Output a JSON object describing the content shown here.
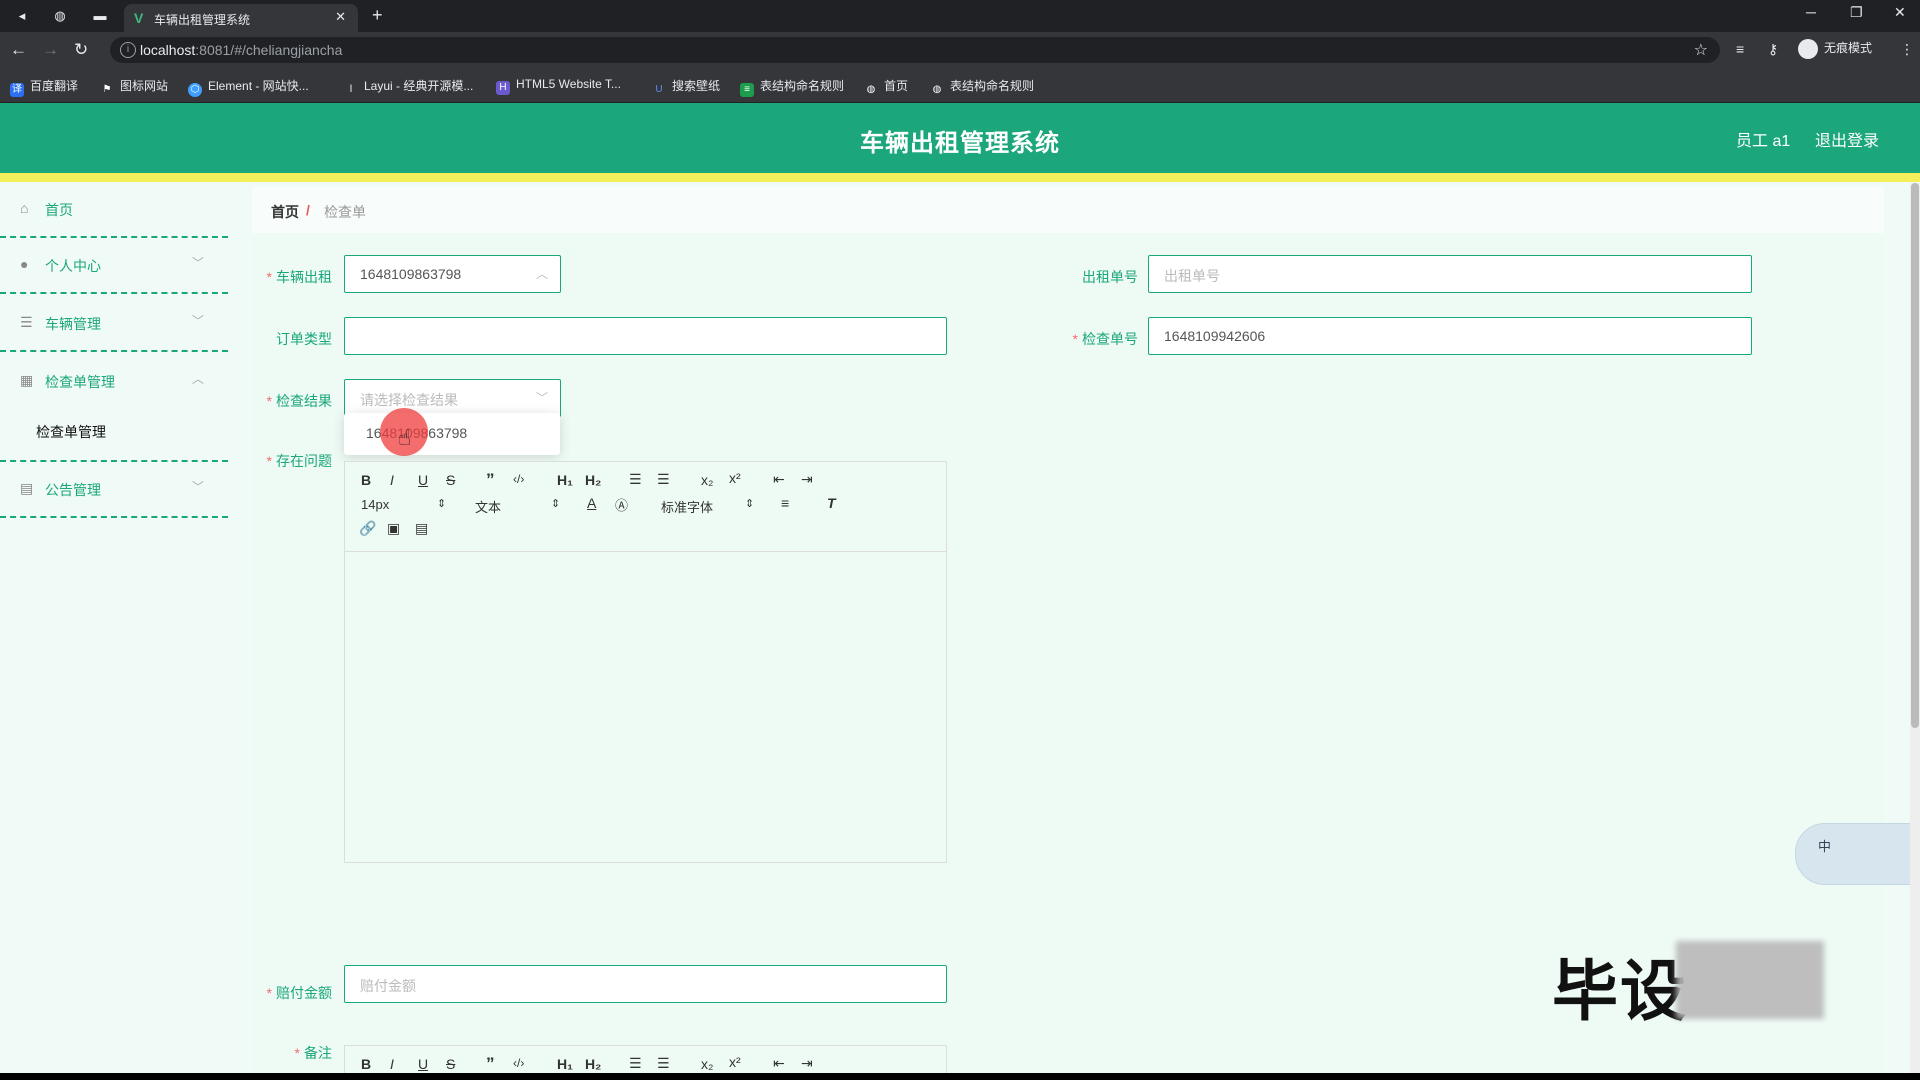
{
  "browser": {
    "tab_title": "车辆出租管理系统",
    "url_host": "localhost",
    "url_rest": ":8081/#/cheliangjiancha",
    "profile_label": "无痕模式",
    "bookmarks": [
      "百度翻译",
      "图标网站",
      "Element - 网站快...",
      "Layui - 经典开源模...",
      "HTML5 Website T...",
      "搜索壁纸",
      "表结构命名规则",
      "首页",
      "表结构命名规则"
    ]
  },
  "header": {
    "title": "车辆出租管理系统",
    "user": "员工 a1",
    "logout": "退出登录"
  },
  "sidebar": {
    "items": [
      {
        "label": "首页",
        "icon": "home-icon"
      },
      {
        "label": "个人中心",
        "icon": "user-icon"
      },
      {
        "label": "车辆管理",
        "icon": "list-icon"
      },
      {
        "label": "检查单管理",
        "icon": "grid-icon"
      },
      {
        "label": "公告管理",
        "icon": "notice-icon"
      }
    ],
    "submenu": "检查单管理"
  },
  "breadcrumb": {
    "home": "首页",
    "separator": "/",
    "current": "检查单"
  },
  "form": {
    "car_rent": {
      "label": "车辆出租",
      "value": "1648109863798"
    },
    "rent_no": {
      "label": "出租单号",
      "placeholder": "出租单号"
    },
    "order_type": {
      "label": "订单类型"
    },
    "check_no": {
      "label": "检查单号",
      "value": "1648109942606"
    },
    "check_result": {
      "label": "检查结果",
      "placeholder": "请选择检查结果"
    },
    "problems": {
      "label": "存在问题"
    },
    "compensation": {
      "label": "赔付金额",
      "placeholder": "赔付金额"
    },
    "remark": {
      "label": "备注"
    },
    "dropdown_option": "1648109863798"
  },
  "editor": {
    "font_size": "14px",
    "text_type": "文本",
    "font_family": "标准字体"
  },
  "watermark": "毕设",
  "ime_label": "中"
}
